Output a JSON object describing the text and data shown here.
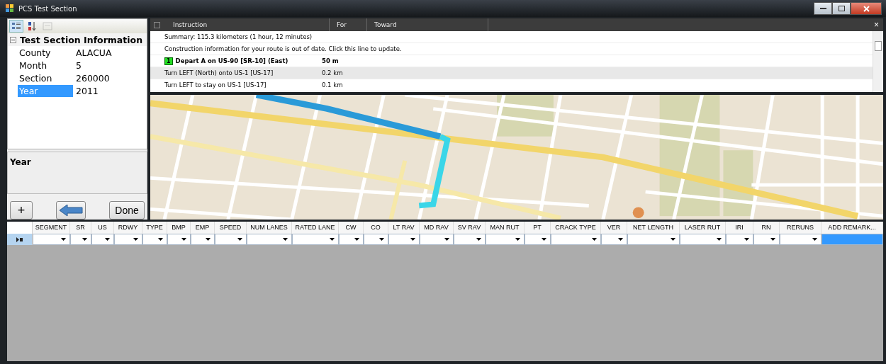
{
  "window": {
    "title": "PCS Test Section"
  },
  "property_grid": {
    "toolbar": [
      {
        "kind": "categorized",
        "selected": true,
        "disabled": false
      },
      {
        "kind": "alphabetical",
        "selected": false,
        "disabled": false
      },
      {
        "kind": "pages",
        "selected": false,
        "disabled": true
      }
    ],
    "categories": [
      {
        "label": "Test Section Information",
        "expanded": true,
        "items": [
          {
            "name": "County",
            "value": "ALACUA",
            "selected": false
          },
          {
            "name": "Month",
            "value": "5",
            "selected": false
          },
          {
            "name": "Section",
            "value": "260000",
            "selected": false
          },
          {
            "name": "Year",
            "value": "2011",
            "selected": true
          }
        ]
      }
    ],
    "description": {
      "title": "Year"
    }
  },
  "buttons": [
    {
      "kind": "add",
      "label": "+"
    },
    {
      "kind": "back"
    },
    {
      "kind": "text",
      "label": "Done"
    }
  ],
  "directions": {
    "columns": [
      "Instruction",
      "For",
      "Toward"
    ],
    "close": "×",
    "rows": [
      {
        "kind": "summary",
        "text": "Summary:  115.3 kilometers (1 hour, 12 minutes)",
        "selected": false
      },
      {
        "kind": "notice",
        "text": "Construction information for your route is out of date.  Click this line to update.",
        "selected": false
      },
      {
        "kind": "start",
        "badge": "1",
        "text": "Depart A on US-90 [SR-10] (East)",
        "distance": "50 m",
        "selected": false
      },
      {
        "kind": "step",
        "text": "Turn LEFT (North) onto US-1 [US-17]",
        "distance": "0.2 km",
        "selected": true
      },
      {
        "kind": "step",
        "text": "Turn LEFT to stay on US-1 [US-17]",
        "distance": "0.1 km",
        "selected": false
      }
    ]
  },
  "grid": {
    "columns": [
      {
        "label": "SEGMENT",
        "kind": "combo"
      },
      {
        "label": "SR",
        "kind": "combo"
      },
      {
        "label": "US",
        "kind": "combo"
      },
      {
        "label": "RDWY",
        "kind": "combo"
      },
      {
        "label": "TYPE",
        "kind": "combo"
      },
      {
        "label": "BMP",
        "kind": "combo"
      },
      {
        "label": "EMP",
        "kind": "combo"
      },
      {
        "label": "SPEED",
        "kind": "combo"
      },
      {
        "label": "NUM LANES",
        "kind": "combo"
      },
      {
        "label": "RATED LANE",
        "kind": "combo"
      },
      {
        "label": "CW",
        "kind": "combo"
      },
      {
        "label": "CO",
        "kind": "combo"
      },
      {
        "label": "LT RAV",
        "kind": "combo"
      },
      {
        "label": "MD RAV",
        "kind": "combo"
      },
      {
        "label": "SV RAV",
        "kind": "combo"
      },
      {
        "label": "MAN RUT",
        "kind": "combo"
      },
      {
        "label": "PT",
        "kind": "combo"
      },
      {
        "label": "CRACK TYPE",
        "kind": "combo"
      },
      {
        "label": "VER",
        "kind": "combo"
      },
      {
        "label": "NET LENGTH",
        "kind": "combo"
      },
      {
        "label": "LASER RUT",
        "kind": "combo"
      },
      {
        "label": "IRI",
        "kind": "combo"
      },
      {
        "label": "RN",
        "kind": "combo"
      },
      {
        "label": "RERUNS",
        "kind": "combo"
      },
      {
        "label": "ADD REMARK...",
        "kind": "button"
      }
    ],
    "rows": [
      {
        "current": true,
        "cells": [
          {
            "selected": false
          },
          {
            "selected": false
          },
          {
            "selected": false
          },
          {
            "selected": false
          },
          {
            "selected": false
          },
          {
            "selected": false
          },
          {
            "selected": false
          },
          {
            "selected": false
          },
          {
            "selected": false
          },
          {
            "selected": false
          },
          {
            "selected": false
          },
          {
            "selected": false
          },
          {
            "selected": false
          },
          {
            "selected": false
          },
          {
            "selected": false
          },
          {
            "selected": false
          },
          {
            "selected": false
          },
          {
            "selected": false
          },
          {
            "selected": false
          },
          {
            "selected": false
          },
          {
            "selected": false
          },
          {
            "selected": false
          },
          {
            "selected": false
          },
          {
            "selected": false
          },
          {
            "selected": true
          }
        ]
      }
    ]
  }
}
